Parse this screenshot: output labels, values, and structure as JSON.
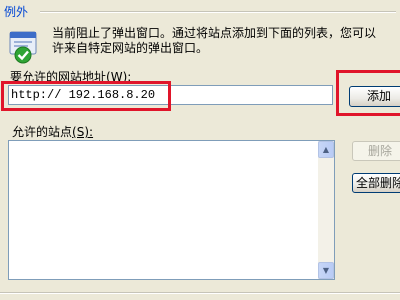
{
  "exceptions": {
    "group_label": "例外",
    "description_line1": "当前阻止了弹出窗口。通过将站点添加到下面的列表，您可以",
    "description_line2": "许来自特定网站的弹出窗口。"
  },
  "address": {
    "label": "要允许的网站地址",
    "shortcut_label": "(W):",
    "value": "http:// 192.168.8.20",
    "add_button_label": "添加"
  },
  "sites": {
    "label": "允许的站点",
    "shortcut_label": "(S):",
    "items": [],
    "remove_button_label": "删除",
    "remove_all_button_label": "全部删除"
  },
  "highlight_color": "#E0152A",
  "icons": {
    "info_shield": "shield-check-icon"
  }
}
